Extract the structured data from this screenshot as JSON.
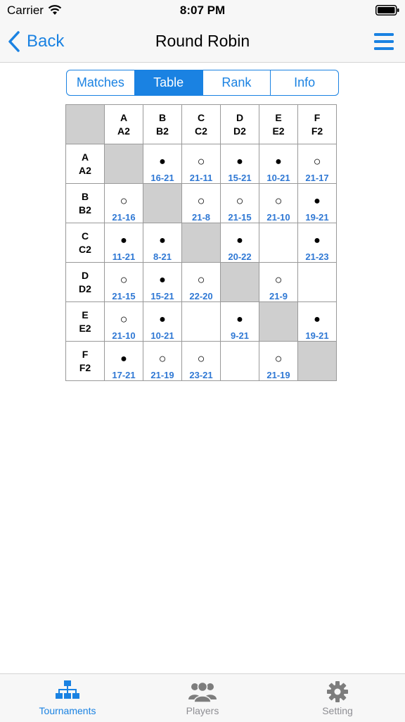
{
  "status_bar": {
    "carrier": "Carrier",
    "time": "8:07 PM"
  },
  "nav": {
    "back_label": "Back",
    "title": "Round Robin"
  },
  "segments": [
    {
      "label": "Matches",
      "active": false
    },
    {
      "label": "Table",
      "active": true
    },
    {
      "label": "Rank",
      "active": false
    },
    {
      "label": "Info",
      "active": false
    }
  ],
  "players": [
    {
      "name": "A",
      "sub": "A2"
    },
    {
      "name": "B",
      "sub": "B2"
    },
    {
      "name": "C",
      "sub": "C2"
    },
    {
      "name": "D",
      "sub": "D2"
    },
    {
      "name": "E",
      "sub": "E2"
    },
    {
      "name": "F",
      "sub": "F2"
    }
  ],
  "results": [
    [
      null,
      {
        "mark": "filled",
        "score": "16-21"
      },
      {
        "mark": "open",
        "score": "21-11"
      },
      {
        "mark": "filled",
        "score": "15-21"
      },
      {
        "mark": "filled",
        "score": "10-21"
      },
      {
        "mark": "open",
        "score": "21-17"
      }
    ],
    [
      {
        "mark": "open",
        "score": "21-16"
      },
      null,
      {
        "mark": "open",
        "score": "21-8"
      },
      {
        "mark": "open",
        "score": "21-15"
      },
      {
        "mark": "open",
        "score": "21-10"
      },
      {
        "mark": "filled",
        "score": "19-21"
      }
    ],
    [
      {
        "mark": "filled",
        "score": "11-21"
      },
      {
        "mark": "filled",
        "score": "8-21"
      },
      null,
      {
        "mark": "filled",
        "score": "20-22"
      },
      {
        "mark": "",
        "score": ""
      },
      {
        "mark": "filled",
        "score": "21-23"
      }
    ],
    [
      {
        "mark": "open",
        "score": "21-15"
      },
      {
        "mark": "filled",
        "score": "15-21"
      },
      {
        "mark": "open",
        "score": "22-20"
      },
      null,
      {
        "mark": "open",
        "score": "21-9"
      },
      {
        "mark": "",
        "score": ""
      }
    ],
    [
      {
        "mark": "open",
        "score": "21-10"
      },
      {
        "mark": "filled",
        "score": "10-21"
      },
      {
        "mark": "",
        "score": ""
      },
      {
        "mark": "filled",
        "score": "9-21"
      },
      null,
      {
        "mark": "filled",
        "score": "19-21"
      }
    ],
    [
      {
        "mark": "filled",
        "score": "17-21"
      },
      {
        "mark": "open",
        "score": "21-19"
      },
      {
        "mark": "open",
        "score": "23-21"
      },
      {
        "mark": "",
        "score": ""
      },
      {
        "mark": "open",
        "score": "21-19"
      },
      null
    ]
  ],
  "tabs": [
    {
      "label": "Tournaments",
      "icon": "tournament-bracket-icon",
      "active": true
    },
    {
      "label": "Players",
      "icon": "people-icon",
      "active": false
    },
    {
      "label": "Setting",
      "icon": "gear-icon",
      "active": false
    }
  ],
  "colors": {
    "accent": "#1a82e2",
    "score": "#2f78d4",
    "diagonal": "#cfcfcf"
  }
}
